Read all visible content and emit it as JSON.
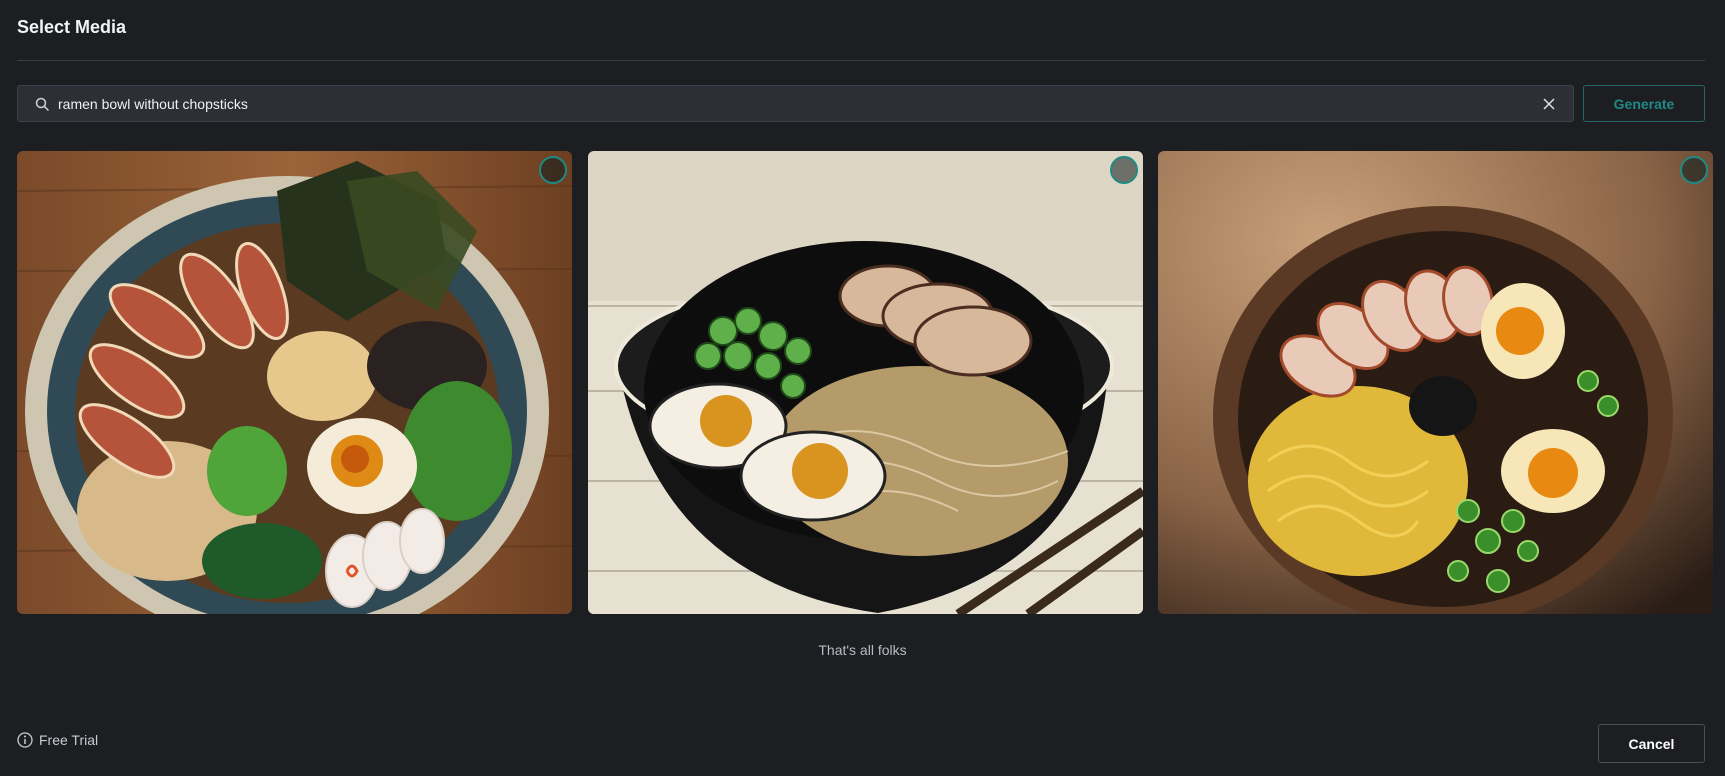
{
  "dialog": {
    "title": "Select Media"
  },
  "search": {
    "value": "ramen bowl without chopsticks",
    "placeholder": "",
    "generate_label": "Generate"
  },
  "results": [
    {
      "style": "overhead illustrated ramen bowl on wood table",
      "selected": false
    },
    {
      "style": "black ink illustration ramen bowl with chopsticks",
      "selected": false
    },
    {
      "style": "photo-style ramen bowl on wooden table",
      "selected": false
    }
  ],
  "end_note": "That's all folks",
  "footer": {
    "free_trial_label": "Free Trial",
    "cancel_label": "Cancel"
  },
  "colors": {
    "background": "#1c1e22",
    "accent": "#1f8a84",
    "input_bg": "#2c2f35"
  },
  "icons": [
    "search-icon",
    "close-icon",
    "info-icon"
  ]
}
